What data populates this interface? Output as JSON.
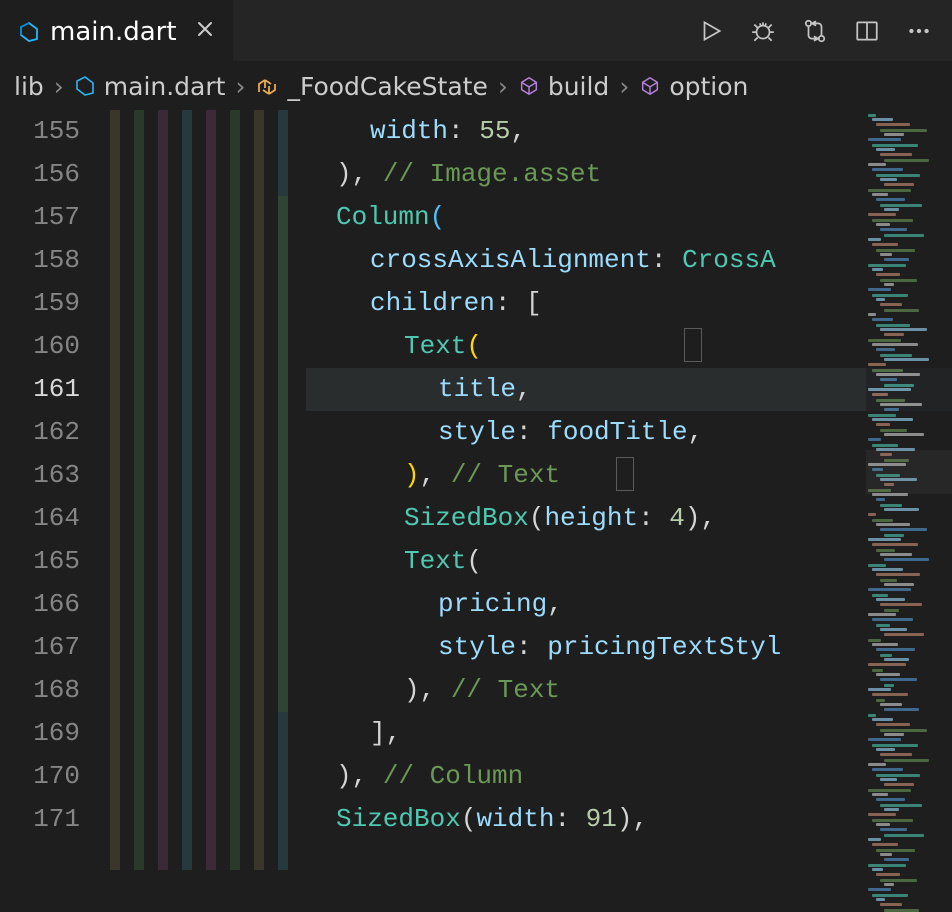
{
  "tab": {
    "label": "main.dart",
    "iconName": "dart-file-icon"
  },
  "toolbarIcons": [
    "run",
    "bug",
    "diff",
    "split",
    "more"
  ],
  "breadcrumbs": [
    {
      "label": "lib",
      "icon": null
    },
    {
      "label": "main.dart",
      "icon": "dart"
    },
    {
      "label": "_FoodCakeState",
      "icon": "class"
    },
    {
      "label": "build",
      "icon": "cube"
    },
    {
      "label": "option",
      "icon": "cube"
    }
  ],
  "currentLine": 161,
  "code": [
    {
      "n": 155,
      "indent": 9,
      "tokens": [
        [
          "prop",
          "width"
        ],
        [
          "punct",
          ": "
        ],
        [
          "num",
          "55"
        ],
        [
          "punct",
          ","
        ]
      ]
    },
    {
      "n": 156,
      "indent": 8,
      "tokens": [
        [
          "punct",
          "), "
        ],
        [
          "comment",
          "// Image.asset"
        ]
      ]
    },
    {
      "n": 157,
      "indent": 8,
      "tokens": [
        [
          "type",
          "Column"
        ],
        [
          "bracket-b",
          "("
        ]
      ]
    },
    {
      "n": 158,
      "indent": 9,
      "tokens": [
        [
          "prop",
          "crossAxisAlignment"
        ],
        [
          "punct",
          ": "
        ],
        [
          "type",
          "CrossA"
        ]
      ]
    },
    {
      "n": 159,
      "indent": 9,
      "tokens": [
        [
          "prop",
          "children"
        ],
        [
          "punct",
          ": ["
        ]
      ]
    },
    {
      "n": 160,
      "indent": 10,
      "tokens": [
        [
          "type",
          "Text"
        ],
        [
          "bracket",
          "("
        ]
      ]
    },
    {
      "n": 161,
      "indent": 11,
      "tokens": [
        [
          "ident",
          "title"
        ],
        [
          "punct",
          ","
        ]
      ]
    },
    {
      "n": 162,
      "indent": 11,
      "tokens": [
        [
          "prop",
          "style"
        ],
        [
          "punct",
          ": "
        ],
        [
          "ident",
          "foodTitle"
        ],
        [
          "punct",
          ","
        ]
      ]
    },
    {
      "n": 163,
      "indent": 10,
      "tokens": [
        [
          "bracket",
          ")"
        ],
        [
          "punct",
          ", "
        ],
        [
          "comment",
          "// Text"
        ]
      ]
    },
    {
      "n": 164,
      "indent": 10,
      "tokens": [
        [
          "type",
          "SizedBox"
        ],
        [
          "punct",
          "("
        ],
        [
          "prop",
          "height"
        ],
        [
          "punct",
          ": "
        ],
        [
          "num",
          "4"
        ],
        [
          "punct",
          "),"
        ]
      ]
    },
    {
      "n": 165,
      "indent": 10,
      "tokens": [
        [
          "type",
          "Text"
        ],
        [
          "punct",
          "("
        ]
      ]
    },
    {
      "n": 166,
      "indent": 11,
      "tokens": [
        [
          "ident",
          "pricing"
        ],
        [
          "punct",
          ","
        ]
      ]
    },
    {
      "n": 167,
      "indent": 11,
      "tokens": [
        [
          "prop",
          "style"
        ],
        [
          "punct",
          ": "
        ],
        [
          "ident",
          "pricingTextStyl"
        ]
      ]
    },
    {
      "n": 168,
      "indent": 10,
      "tokens": [
        [
          "punct",
          "), "
        ],
        [
          "comment",
          "// Text"
        ]
      ]
    },
    {
      "n": 169,
      "indent": 9,
      "tokens": [
        [
          "punct",
          "],"
        ]
      ]
    },
    {
      "n": 170,
      "indent": 8,
      "tokens": [
        [
          "punct",
          "), "
        ],
        [
          "comment",
          "// Column"
        ]
      ]
    },
    {
      "n": 171,
      "indent": 8,
      "tokens": [
        [
          "type",
          "SizedBox"
        ],
        [
          "punct",
          "("
        ],
        [
          "prop",
          "width"
        ],
        [
          "punct",
          ": "
        ],
        [
          "num",
          "91"
        ],
        [
          "punct",
          "),"
        ]
      ]
    }
  ]
}
